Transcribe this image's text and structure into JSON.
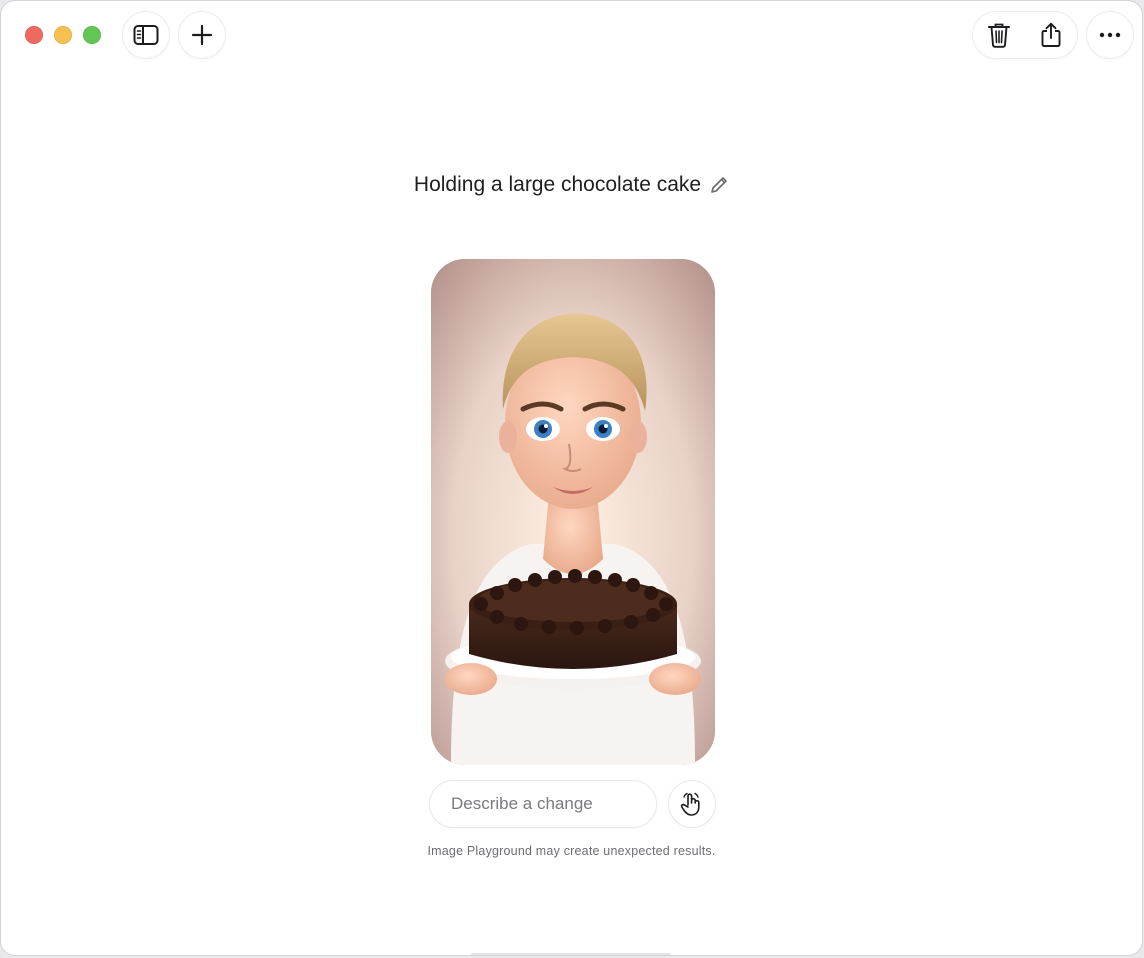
{
  "window": {
    "controls": [
      "close",
      "minimize",
      "maximize"
    ]
  },
  "toolbar": {
    "sidebar_icon": "sidebar-icon",
    "new_icon": "plus-icon",
    "trash_icon": "trash-icon",
    "share_icon": "share-icon",
    "more_icon": "ellipsis-icon"
  },
  "main": {
    "title": "Holding a large chocolate cake",
    "edit_icon": "pencil-icon",
    "image": {
      "subject": "image-preview"
    },
    "input": {
      "placeholder": "Describe a change"
    },
    "gesture_icon": "hand-pointer-icon",
    "disclaimer": "Image Playground may create unexpected results."
  },
  "colors": {
    "close": "#ee6a5f",
    "minimize": "#f5c04f",
    "maximize": "#62c554",
    "text": "#1f1f1f",
    "muted": "#6e6e72"
  }
}
